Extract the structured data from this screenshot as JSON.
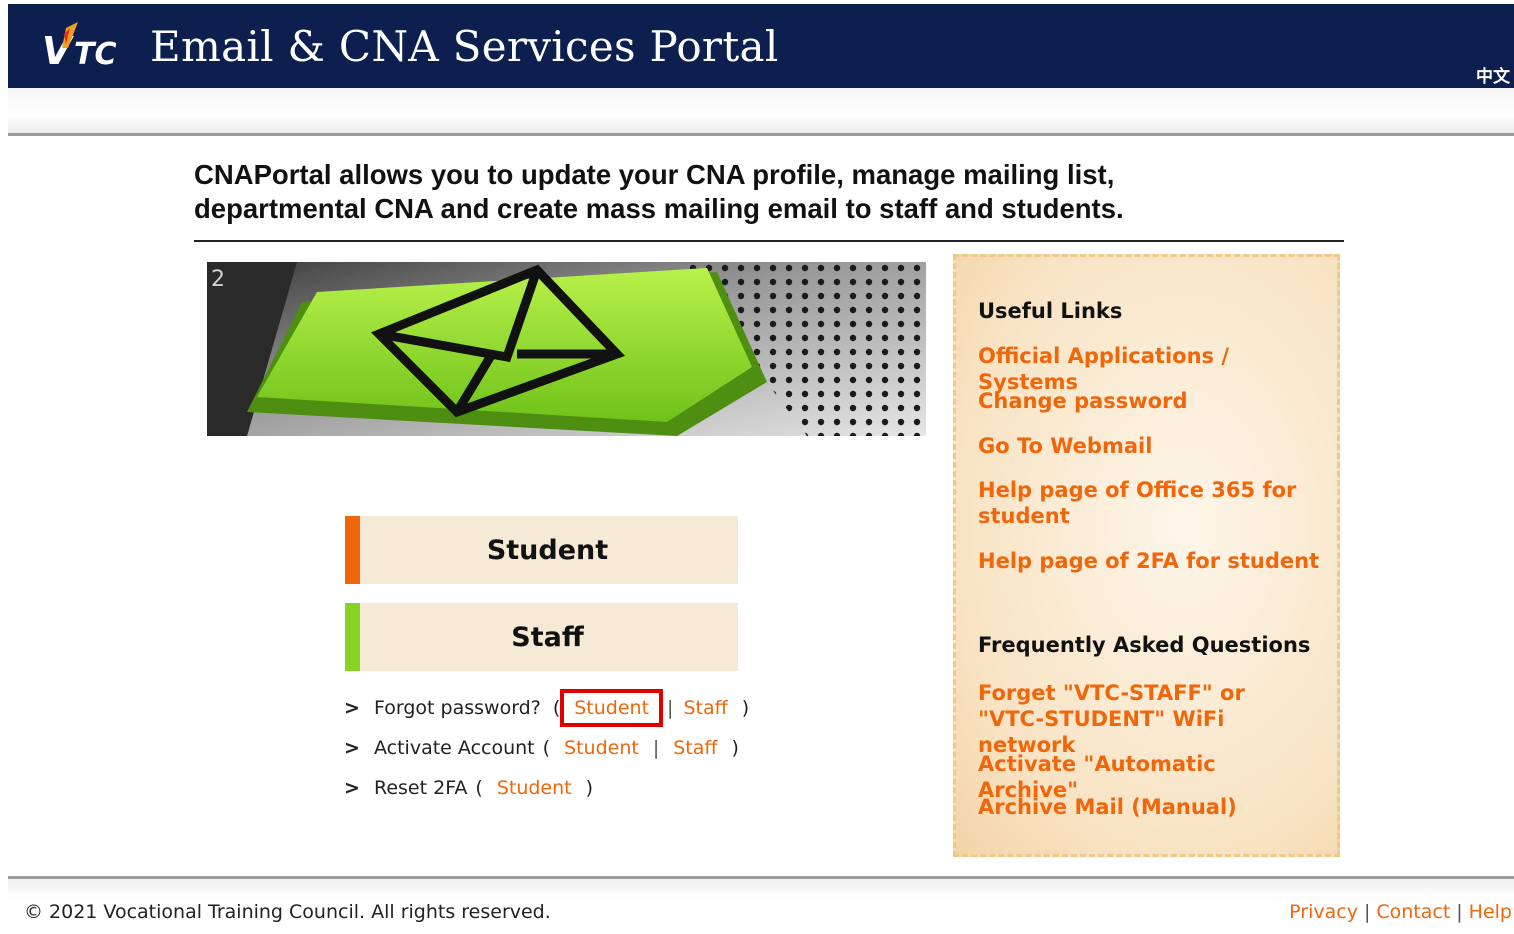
{
  "header": {
    "logo_text": "VTC",
    "title": "Email & CNA Services Portal",
    "language_link": "中文",
    "colors": {
      "background": "#0c1f4f",
      "text": "#ffffff"
    }
  },
  "intro": {
    "line1": "CNAPortal allows you to update your CNA profile, manage mailing list,",
    "line2": "departmental CNA and create mass mailing email to staff and students."
  },
  "login": {
    "student_label": "Student",
    "staff_label": "Staff",
    "colors": {
      "student_stripe": "#f0660a",
      "staff_stripe": "#86d322",
      "button_bg": "#f5ead5"
    }
  },
  "account_links": {
    "arrow": ">",
    "forgot_password": {
      "label": "Forgot password?",
      "open": "(",
      "student": "Student",
      "separator": "|",
      "staff": "Staff",
      "close": ")"
    },
    "activate_account": {
      "label": "Activate Account",
      "open": "(",
      "student": "Student",
      "separator": "|",
      "staff": "Staff",
      "close": ")"
    },
    "reset_2fa": {
      "label": "Reset 2FA",
      "open": "(",
      "student": "Student",
      "close": ")"
    },
    "highlight_color": "#e00000"
  },
  "useful_links": {
    "heading": "Useful Links",
    "items": [
      "Official Applications / Systems",
      "Change password",
      "Go To Webmail",
      "Help page of Office 365 for student",
      "Help page of 2FA for student"
    ]
  },
  "faq": {
    "heading": "Frequently Asked Questions",
    "items": [
      "Forget \"VTC-STAFF\" or \"VTC-STUDENT\" WiFi network",
      "Activate \"Automatic Archive\"",
      "Archive Mail (Manual)"
    ]
  },
  "footer": {
    "copyright": "© 2021 Vocational Training Council. All rights reserved.",
    "links": [
      "Privacy",
      "Contact",
      "Help"
    ],
    "separator": "|"
  },
  "accent_color": "#f0660a"
}
